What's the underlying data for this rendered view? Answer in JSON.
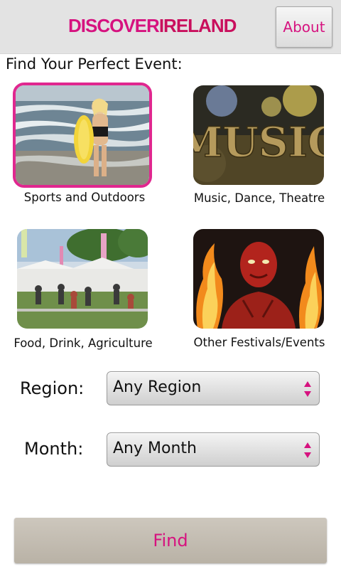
{
  "header": {
    "logo_part1": "DISCOVER",
    "logo_part2": "IRELAND",
    "about_label": "About"
  },
  "main": {
    "title": "Find Your Perfect Event:",
    "categories": [
      {
        "label": "Sports and Outdoors",
        "selected": true
      },
      {
        "label": "Music, Dance, Theatre",
        "selected": false,
        "image_text": "MUSIC"
      },
      {
        "label": "Food, Drink, Agriculture",
        "selected": false
      },
      {
        "label": "Other Festivals/Events",
        "selected": false
      }
    ]
  },
  "filters": {
    "region_label": "Region:",
    "region_value": "Any Region",
    "month_label": "Month:",
    "month_value": "Any Month"
  },
  "actions": {
    "find_label": "Find"
  },
  "colors": {
    "accent": "#d6127f",
    "header_bg": "#e3e3e3",
    "find_button_bg": "#c5bfb5"
  }
}
